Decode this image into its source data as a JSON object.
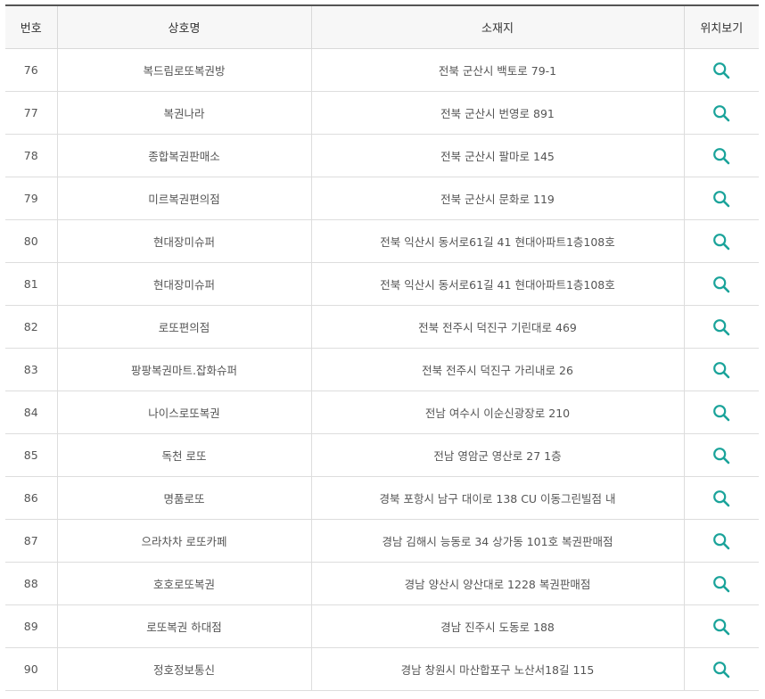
{
  "table": {
    "headers": {
      "number": "번호",
      "name": "상호명",
      "address": "소재지",
      "location": "위치보기"
    },
    "rows": [
      {
        "number": "76",
        "name": "복드림로또복권방",
        "address": "전북 군산시 백토로 79-1"
      },
      {
        "number": "77",
        "name": "복권나라",
        "address": "전북 군산시 번영로 891"
      },
      {
        "number": "78",
        "name": "종합복권판매소",
        "address": "전북 군산시 팔마로 145"
      },
      {
        "number": "79",
        "name": "미르복권편의점",
        "address": "전북 군산시 문화로 119"
      },
      {
        "number": "80",
        "name": "현대장미슈퍼",
        "address": "전북 익산시 동서로61길 41 현대아파트1층108호"
      },
      {
        "number": "81",
        "name": "현대장미슈퍼",
        "address": "전북 익산시 동서로61길 41 현대아파트1층108호"
      },
      {
        "number": "82",
        "name": "로또편의점",
        "address": "전북 전주시 덕진구 기린대로 469"
      },
      {
        "number": "83",
        "name": "팡팡복권마트.잡화슈퍼",
        "address": "전북 전주시 덕진구 가리내로 26"
      },
      {
        "number": "84",
        "name": "나이스로또복권",
        "address": "전남 여수시 이순신광장로 210"
      },
      {
        "number": "85",
        "name": "독천 로또",
        "address": "전남 영암군 영산로 27 1층"
      },
      {
        "number": "86",
        "name": "명품로또",
        "address": "경북 포항시 남구 대이로 138 CU 이동그린빌점 내"
      },
      {
        "number": "87",
        "name": "으라차차 로또카페",
        "address": "경남 김해시 능동로 34 상가동 101호 복권판매점"
      },
      {
        "number": "88",
        "name": "호호로또복권",
        "address": "경남 양산시 양산대로 1228 복권판매점"
      },
      {
        "number": "89",
        "name": "로또복권 하대점",
        "address": "경남 진주시 도동로 188"
      },
      {
        "number": "90",
        "name": "정호정보통신",
        "address": "경남 창원시 마산합포구 노산서18길 115"
      }
    ],
    "location_icon": "search-icon"
  },
  "colors": {
    "accent": "#1aa39a",
    "header_bg": "#f7f7f7",
    "border": "#dddddd",
    "text": "#555555"
  }
}
